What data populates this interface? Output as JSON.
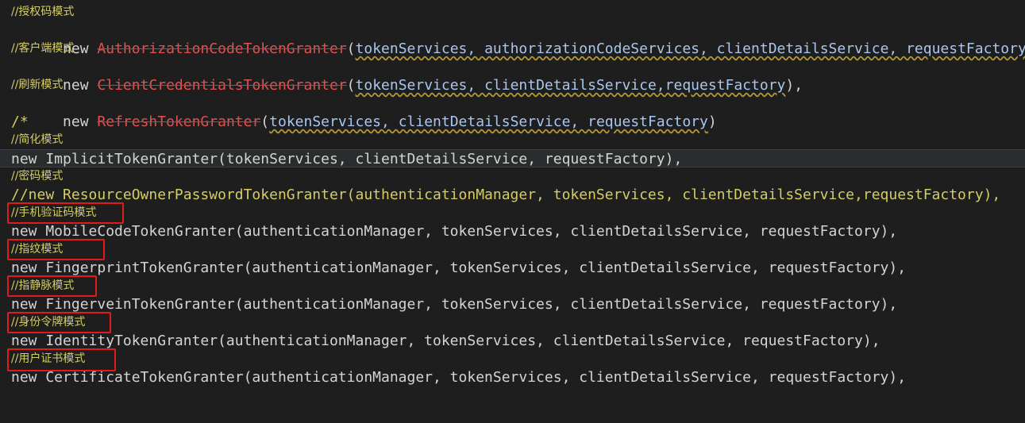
{
  "lines": [
    {
      "type": "comment",
      "text": "//授权码模式"
    },
    {
      "type": "code-err",
      "kw": "new",
      "cls": "AuthorizationCodeTokenGranter",
      "args": "tokenServices, authorizationCodeServices, clientDetailsService, requestFactory",
      "tail": "),"
    },
    {
      "type": "comment",
      "text": "//客户端模式"
    },
    {
      "type": "code-err",
      "kw": "new",
      "cls": "ClientCredentialsTokenGranter",
      "args": "tokenServices, clientDetailsService,requestFactory",
      "tail": "),"
    },
    {
      "type": "comment",
      "text": "//刷新模式"
    },
    {
      "type": "code-err",
      "kw": "new",
      "cls": "RefreshTokenGranter",
      "args": "tokenServices, clientDetailsService, requestFactory",
      "tail": ")"
    },
    {
      "type": "comment",
      "text": "/*"
    },
    {
      "type": "comment",
      "text": "//简化模式"
    },
    {
      "type": "code",
      "text": "new ImplicitTokenGranter(tokenServices, clientDetailsService, requestFactory),"
    },
    {
      "type": "comment",
      "text": "//密码模式"
    },
    {
      "type": "comment-code",
      "text": "//new ResourceOwnerPasswordTokenGranter(authenticationManager, tokenServices, clientDetailsService,requestFactory),"
    },
    {
      "type": "comment",
      "text": "//手机验证码模式"
    },
    {
      "type": "code",
      "text": "new MobileCodeTokenGranter(authenticationManager, tokenServices, clientDetailsService, requestFactory),"
    },
    {
      "type": "comment",
      "text": "//指纹模式"
    },
    {
      "type": "code",
      "text": "new FingerprintTokenGranter(authenticationManager, tokenServices, clientDetailsService, requestFactory),"
    },
    {
      "type": "comment",
      "text": "//指静脉模式"
    },
    {
      "type": "code",
      "text": "new FingerveinTokenGranter(authenticationManager, tokenServices, clientDetailsService, requestFactory),"
    },
    {
      "type": "comment",
      "text": "//身份令牌模式"
    },
    {
      "type": "code",
      "text": "new IdentityTokenGranter(authenticationManager, tokenServices, clientDetailsService, requestFactory),"
    },
    {
      "type": "comment",
      "text": "//用户证书模式"
    },
    {
      "type": "code",
      "text": "new CertificateTokenGranter(authenticationManager, tokenServices, clientDetailsService, requestFactory),"
    }
  ],
  "highlight_color": "#e11b1b"
}
